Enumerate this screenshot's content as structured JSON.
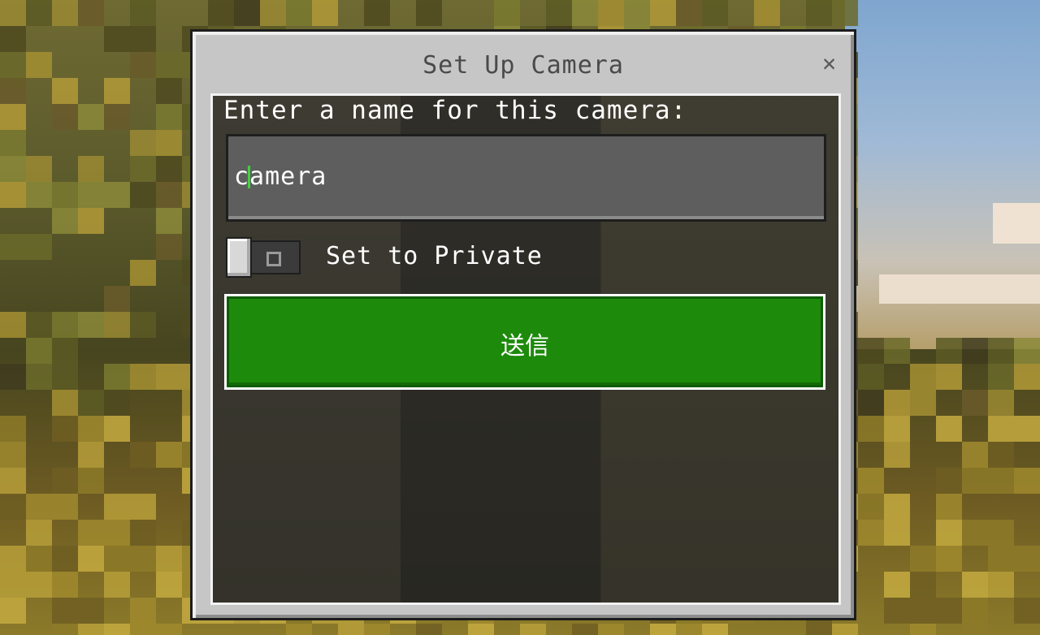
{
  "dialog": {
    "title": "Set Up Camera",
    "close_symbol": "✕",
    "prompt": "Enter a name for this camera:",
    "name_input": {
      "value": "camera"
    },
    "private_toggle": {
      "label": "Set to Private",
      "state_symbol": "O",
      "enabled": false
    },
    "submit_label": "送信"
  },
  "colors": {
    "accent_green": "#1d8a0b",
    "panel": "#c6c6c6",
    "caret": "#3fd13f"
  }
}
